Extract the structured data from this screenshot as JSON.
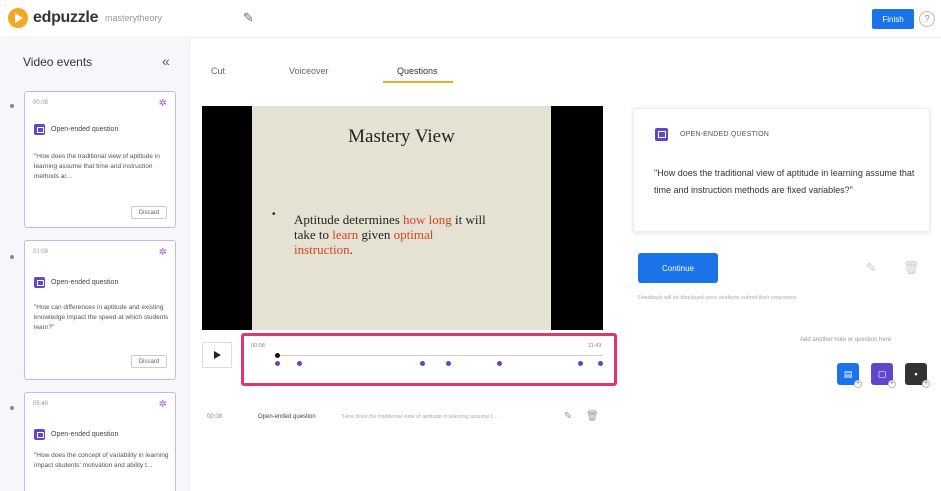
{
  "header": {
    "logo_text": "edpuzzle",
    "project_name": "masterytheory",
    "edit_icon": "pencil-icon",
    "finish_label": "Finish",
    "help_label": "?"
  },
  "sidebar": {
    "title": "Video events",
    "collapse_glyph": "«",
    "events": [
      {
        "time": "00:08",
        "type": "Open-ended question",
        "text": "\"How does the traditional view of aptitude in learning assume that time and instruction methods ar...",
        "action": "Discard"
      },
      {
        "time": "01:08",
        "type": "Open-ended question",
        "text": "\"How can differences in aptitude and existing knowledge impact the speed at which students learn?\"",
        "action": "Discard"
      },
      {
        "time": "05:48",
        "type": "Open-ended question",
        "text": "\"How does the concept of variability in learning impact students' motivation and ability t..."
      }
    ]
  },
  "tabs": [
    {
      "label": "Cut",
      "active": false
    },
    {
      "label": "Voiceover",
      "active": false
    },
    {
      "label": "Questions",
      "active": true
    }
  ],
  "video": {
    "slide_title": "Mastery View",
    "bullet": "•",
    "line1_a": "Aptitude determines ",
    "line1_hl": "how long",
    "line1_b": " it will",
    "line2_a": "take to ",
    "line2_hl": "learn",
    "line2_b": " given ",
    "line2_hl2": "optimal",
    "line3_hl": "instruction",
    "line3_b": "."
  },
  "timeline": {
    "start_time": "00:08",
    "end_time": "11:43",
    "playhead_fraction": 0.0,
    "marker_fractions": [
      0.0,
      0.07,
      0.45,
      0.53,
      0.69,
      0.94,
      1.0
    ]
  },
  "question_list": [
    {
      "time": "00:08",
      "type": "Open-ended question",
      "text": "\"How does the traditional view of aptitude in learning assume t..."
    }
  ],
  "question_panel": {
    "type_label": "OPEN-ENDED QUESTION",
    "text": "\"How does the traditional view of aptitude in learning assume that time and instruction methods are fixed variables?\"",
    "continue_label": "Continue",
    "feedback_note": "Feedback will be displayed once students submit their responses",
    "add_note": "Add another note or question here"
  },
  "add_buttons": [
    {
      "icon": "open-question-icon",
      "color": "#1a73e8"
    },
    {
      "icon": "multiple-choice-icon",
      "color": "#6046c8"
    },
    {
      "icon": "note-icon",
      "color": "#333333"
    }
  ],
  "colors": {
    "accent": "#1a73e8",
    "question": "#6046c8",
    "tab_underline": "#f5a623",
    "highlight": "#e0356f"
  }
}
